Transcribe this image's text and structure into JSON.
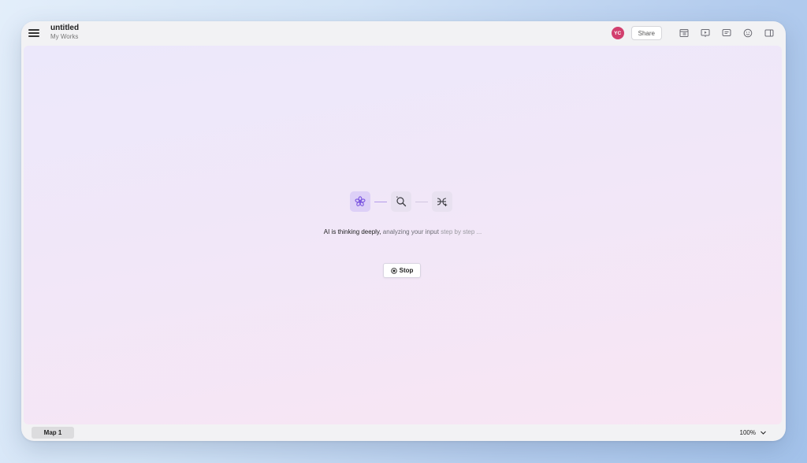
{
  "document": {
    "title": "untitled",
    "folder": "My Works"
  },
  "header": {
    "avatar_initials": "YC",
    "avatar_color": "#d23f6e",
    "share_label": "Share",
    "tools": [
      "outline-view-icon",
      "presentation-icon",
      "comment-icon",
      "emoji-icon",
      "sidebar-toggle-icon"
    ]
  },
  "ai_status": {
    "steps": [
      "sparkle-flower-icon",
      "search-analyze-icon",
      "merge-add-icon"
    ],
    "message_part1": "AI is thinking deeply, ",
    "message_part2": "analyzing your input ",
    "message_part3": "step by step ...",
    "stop_label": "Stop"
  },
  "footer": {
    "map_tab": "Map 1",
    "zoom": "100%"
  },
  "colors": {
    "accent_purple": "#7c57e0",
    "canvas_start": "#ece8fb",
    "canvas_end": "#f8e6f3"
  }
}
